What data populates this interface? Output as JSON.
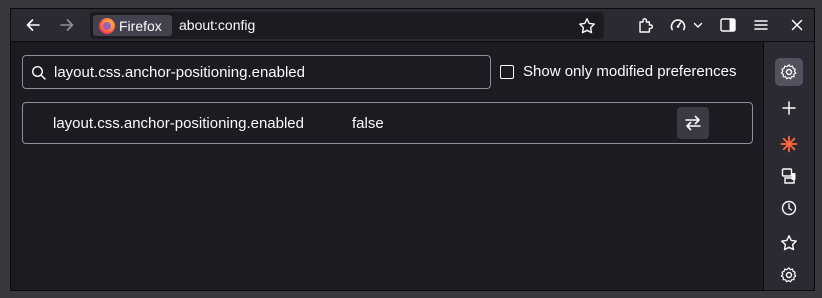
{
  "toolbar": {
    "back_icon": "arrow-left-icon",
    "forward_icon": "arrow-right-icon",
    "identity_label": "Firefox",
    "url": "about:config",
    "bookmark_icon": "star-icon",
    "extensions_icon": "puzzle-icon",
    "speedometer_icon": "gauge-icon",
    "sidebar_toggle_icon": "sidebar-icon",
    "menu_icon": "hamburger-icon",
    "close_icon": "close-icon"
  },
  "config": {
    "search_value": "layout.css.anchor-positioning.enabled",
    "show_modified_label": "Show only modified preferences",
    "show_modified_checked": false,
    "preferences": [
      {
        "name": "layout.css.anchor-positioning.enabled",
        "value": "false",
        "action_icon": "toggle-arrows-icon"
      }
    ]
  },
  "sidebar": {
    "items": [
      {
        "icon": "gear-icon",
        "active": true
      },
      {
        "icon": "plus-icon",
        "active": false
      },
      {
        "icon": "ai-sparkle-icon",
        "active": false
      },
      {
        "icon": "synced-devices-icon",
        "active": false
      },
      {
        "icon": "history-icon",
        "active": false
      },
      {
        "icon": "bookmark-star-icon",
        "active": false
      },
      {
        "icon": "customize-gear-icon",
        "active": false
      }
    ]
  },
  "colors": {
    "background": "#1c1b22",
    "toolbar": "#2b2a33",
    "text": "#fbfbfe",
    "border": "#8f8f9d",
    "sparkle": "#ff6a3d"
  }
}
